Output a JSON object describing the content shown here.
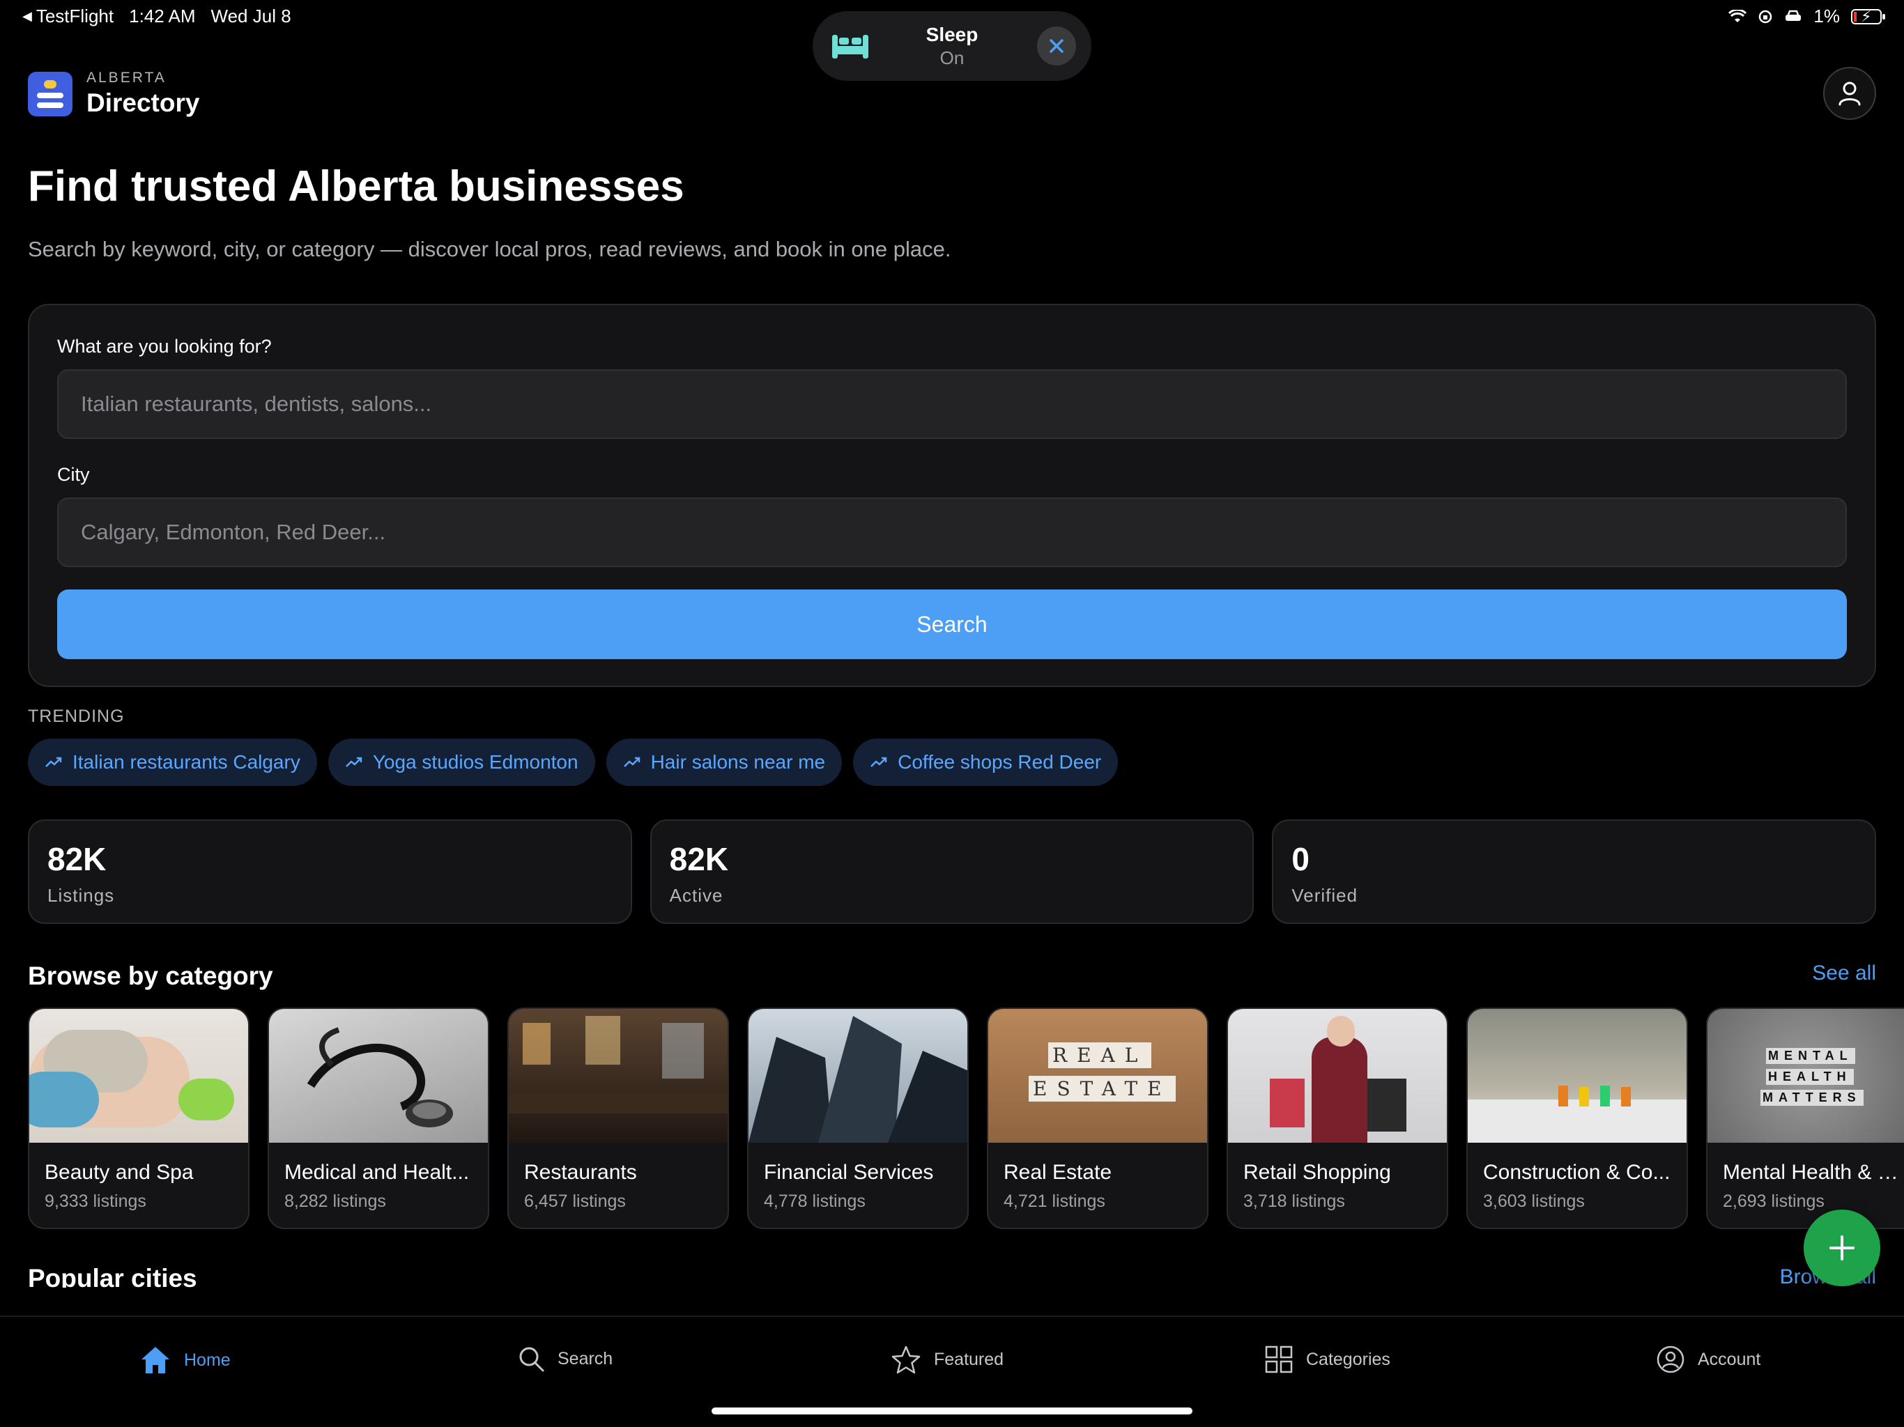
{
  "status_bar": {
    "back_app": "TestFlight",
    "time": "1:42 AM",
    "date": "Wed Jul 8",
    "battery": "1%"
  },
  "sleep_banner": {
    "title": "Sleep",
    "status": "On"
  },
  "header": {
    "brand_sub": "ALBERTA",
    "brand_title": "Directory"
  },
  "hero": {
    "title": "Find trusted Alberta businesses",
    "subtitle": "Search by keyword, city, or category — discover local pros, read reviews, and book in one place."
  },
  "search": {
    "what_label": "What are you looking for?",
    "what_placeholder": "Italian restaurants, dentists, salons...",
    "city_label": "City",
    "city_placeholder": "Calgary, Edmonton, Red Deer...",
    "button": "Search"
  },
  "trending": {
    "label": "TRENDING",
    "items": [
      "Italian restaurants Calgary",
      "Yoga studios Edmonton",
      "Hair salons near me",
      "Coffee shops Red Deer"
    ]
  },
  "stats": [
    {
      "value": "82K",
      "label": "Listings"
    },
    {
      "value": "82K",
      "label": "Active"
    },
    {
      "value": "0",
      "label": "Verified"
    }
  ],
  "browse": {
    "title": "Browse by category",
    "see_all": "See all",
    "categories": [
      {
        "name": "Beauty and Spa",
        "count": "9,333 listings"
      },
      {
        "name": "Medical and Healt...",
        "count": "8,282 listings"
      },
      {
        "name": "Restaurants",
        "count": "6,457 listings"
      },
      {
        "name": "Financial Services",
        "count": "4,778 listings"
      },
      {
        "name": "Real Estate",
        "count": "4,721 listings",
        "image_text_1": "REAL",
        "image_text_2": "ESTATE"
      },
      {
        "name": "Retail Shopping",
        "count": "3,718 listings"
      },
      {
        "name": "Construction & Co...",
        "count": "3,603 listings"
      },
      {
        "name": "Mental Health & W...",
        "count": "2,693 listings",
        "image_text_1": "MENTAL",
        "image_text_2": "HEALTH",
        "image_text_3": "MATTERS"
      }
    ]
  },
  "popular": {
    "title": "Popular cities",
    "browse_all": "Browse all"
  },
  "tabs": [
    {
      "label": "Home",
      "icon": "home-icon"
    },
    {
      "label": "Search",
      "icon": "search-icon"
    },
    {
      "label": "Featured",
      "icon": "star-icon"
    },
    {
      "label": "Categories",
      "icon": "grid-icon"
    },
    {
      "label": "Account",
      "icon": "account-icon"
    }
  ],
  "colors": {
    "accent": "#4d9ff5",
    "fab": "#1fa34a",
    "chip_bg": "#132036",
    "card_bg": "#141416"
  }
}
